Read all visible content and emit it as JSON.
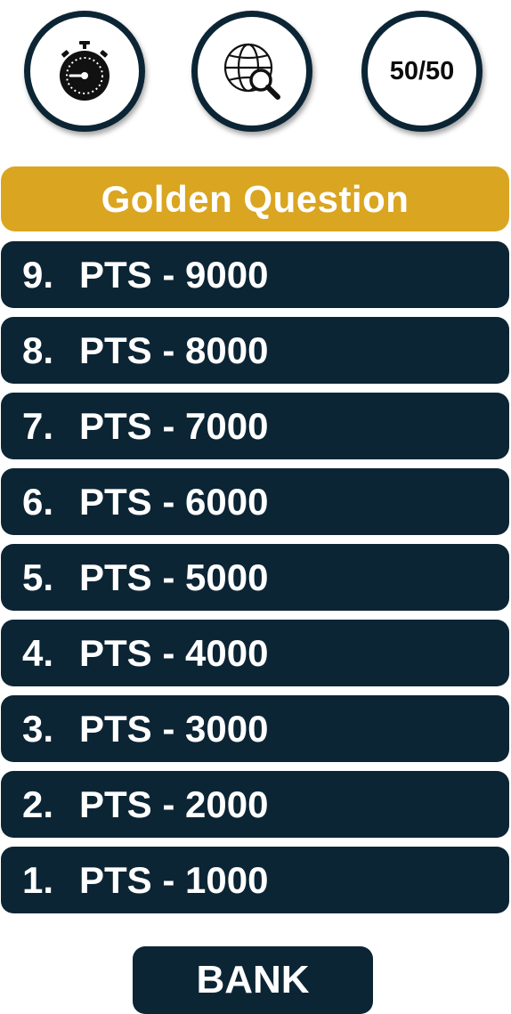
{
  "lifelines": [
    {
      "id": "timer",
      "icon": "stopwatch-icon"
    },
    {
      "id": "search",
      "icon": "globe-search-icon"
    },
    {
      "id": "fifty",
      "label": "50/50"
    }
  ],
  "golden_question": {
    "label": "Golden Question",
    "color": "#daa520"
  },
  "ladder": [
    {
      "number": "9.",
      "label": "PTS - 9000"
    },
    {
      "number": "8.",
      "label": "PTS - 8000"
    },
    {
      "number": "7.",
      "label": "PTS - 7000"
    },
    {
      "number": "6.",
      "label": "PTS - 6000"
    },
    {
      "number": "5.",
      "label": "PTS - 5000"
    },
    {
      "number": "4.",
      "label": "PTS - 4000"
    },
    {
      "number": "3.",
      "label": "PTS - 3000"
    },
    {
      "number": "2.",
      "label": "PTS - 2000"
    },
    {
      "number": "1.",
      "label": "PTS - 1000"
    }
  ],
  "bank": {
    "label": "BANK"
  },
  "colors": {
    "navy": "#0c2535",
    "gold": "#daa520"
  }
}
